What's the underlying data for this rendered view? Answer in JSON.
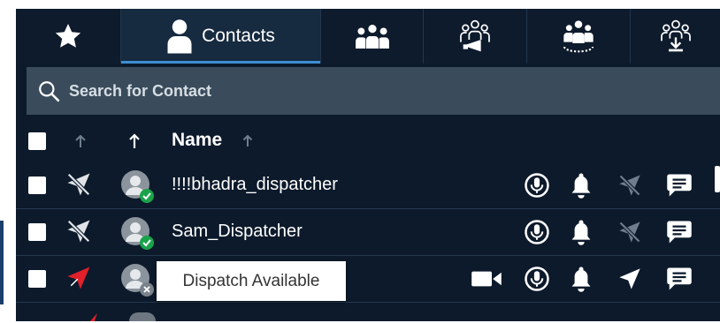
{
  "tabs": [
    {
      "id": "favorites",
      "icon": "star-icon",
      "label": ""
    },
    {
      "id": "contacts",
      "icon": "person-icon",
      "label": "Contacts",
      "active": true
    },
    {
      "id": "groups",
      "icon": "group-icon",
      "label": ""
    },
    {
      "id": "broadcast",
      "icon": "broadcast-group-icon",
      "label": ""
    },
    {
      "id": "dynamic",
      "icon": "dynamic-group-icon",
      "label": ""
    },
    {
      "id": "import",
      "icon": "import-group-icon",
      "label": ""
    }
  ],
  "search": {
    "placeholder": "Search for Contact"
  },
  "header": {
    "name_label": "Name"
  },
  "contacts": [
    {
      "name": "!!!!bhadra_dispatcher",
      "status": "available",
      "location": "off"
    },
    {
      "name": "Sam_Dispatcher",
      "status": "available",
      "location": "off"
    },
    {
      "name": "",
      "status": "offline",
      "location": "on"
    }
  ],
  "tooltip": {
    "text": "Dispatch Available"
  },
  "colors": {
    "accent": "#3d8fd4",
    "online": "#1aa34a",
    "location_active": "#e0202a",
    "background": "#0c1a2b"
  }
}
